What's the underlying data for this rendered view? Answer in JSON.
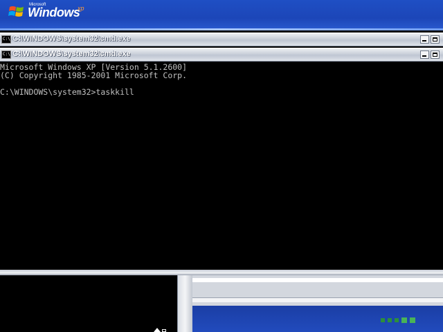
{
  "desktop": {
    "logo_small_text": "Microsoft",
    "logo_word": "Windows",
    "logo_sup": "xp"
  },
  "windows": {
    "back_title": "C:\\WINDOWS\\system32\\cmd.exe",
    "front_title": "C:\\WINDOWS\\system32\\cmd.exe",
    "icon_label": "C:\\"
  },
  "console": {
    "lines": [
      "Microsoft Windows XP [Version 5.1.2600]",
      "(C) Copyright 1985-2001 Microsoft Corp.",
      "",
      "C:\\WINDOWS\\system32>taskkill"
    ]
  },
  "colors": {
    "console_bg": "#000000",
    "console_fg": "#c0c0c0",
    "xp_blue": "#1f4fc4",
    "indicator_green": "#2c8f3a"
  }
}
